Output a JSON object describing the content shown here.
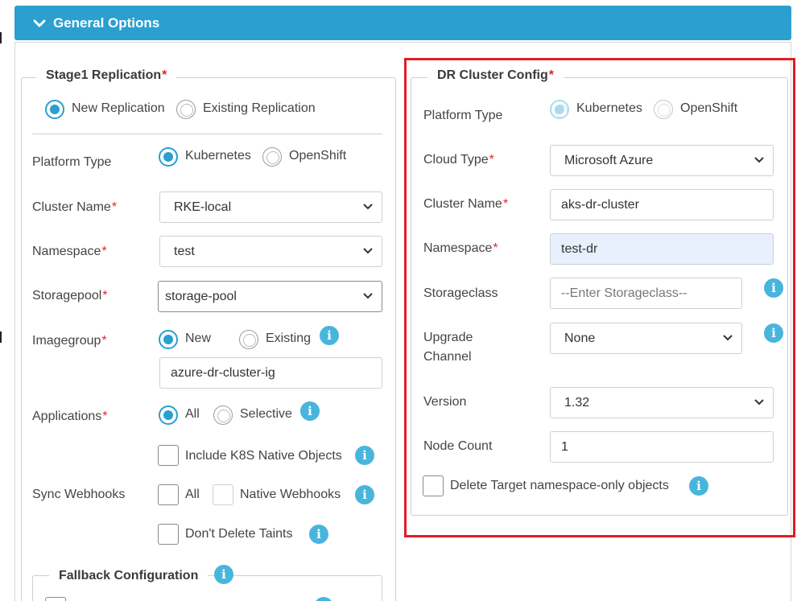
{
  "header": {
    "title": "General Options",
    "icon": "chevron-down-icon"
  },
  "stage1": {
    "legend": "Stage1 Replication",
    "required_mark": "*",
    "replication": {
      "new_label": "New Replication",
      "existing_label": "Existing Replication",
      "selected": "new"
    },
    "platform": {
      "label": "Platform Type",
      "kubernetes_label": "Kubernetes",
      "openshift_label": "OpenShift",
      "selected": "kubernetes"
    },
    "cluster_name": {
      "label": "Cluster Name",
      "value": "RKE-local"
    },
    "namespace": {
      "label": "Namespace",
      "value": "test"
    },
    "storagepool": {
      "label": "Storagepool",
      "value": "storage-pool"
    },
    "imagegroup": {
      "label": "Imagegroup",
      "new_label": "New",
      "existing_label": "Existing",
      "selected": "new",
      "value": "azure-dr-cluster-ig"
    },
    "applications": {
      "label": "Applications",
      "all_label": "All",
      "selective_label": "Selective",
      "selected": "all",
      "include_native_label": "Include K8S Native Objects"
    },
    "sync_webhooks": {
      "label": "Sync Webhooks",
      "all_label": "All",
      "native_label": "Native Webhooks"
    },
    "dont_delete_taints_label": "Don't Delete Taints",
    "fallback": {
      "legend": "Fallback Configuration"
    }
  },
  "dr_cluster": {
    "legend": "DR Cluster Config",
    "required_mark": "*",
    "platform": {
      "label": "Platform Type",
      "kubernetes_label": "Kubernetes",
      "openshift_label": "OpenShift",
      "selected": "kubernetes"
    },
    "cloud_type": {
      "label": "Cloud Type",
      "value": "Microsoft Azure"
    },
    "cluster_name": {
      "label": "Cluster Name",
      "value": "aks-dr-cluster"
    },
    "namespace": {
      "label": "Namespace",
      "value": "test-dr"
    },
    "storageclass": {
      "label": "Storageclass",
      "placeholder": "--Enter Storageclass--"
    },
    "upgrade_channel": {
      "label_line1": "Upgrade",
      "label_line2": "Channel",
      "value": "None"
    },
    "version": {
      "label": "Version",
      "value": "1.32"
    },
    "node_count": {
      "label": "Node Count",
      "value": "1"
    },
    "delete_target_label": "Delete Target namespace-only objects"
  },
  "colors": {
    "accent": "#2a9fd0",
    "required": "#e0242e",
    "highlight": "#e21c25",
    "info": "#48b5dd"
  }
}
